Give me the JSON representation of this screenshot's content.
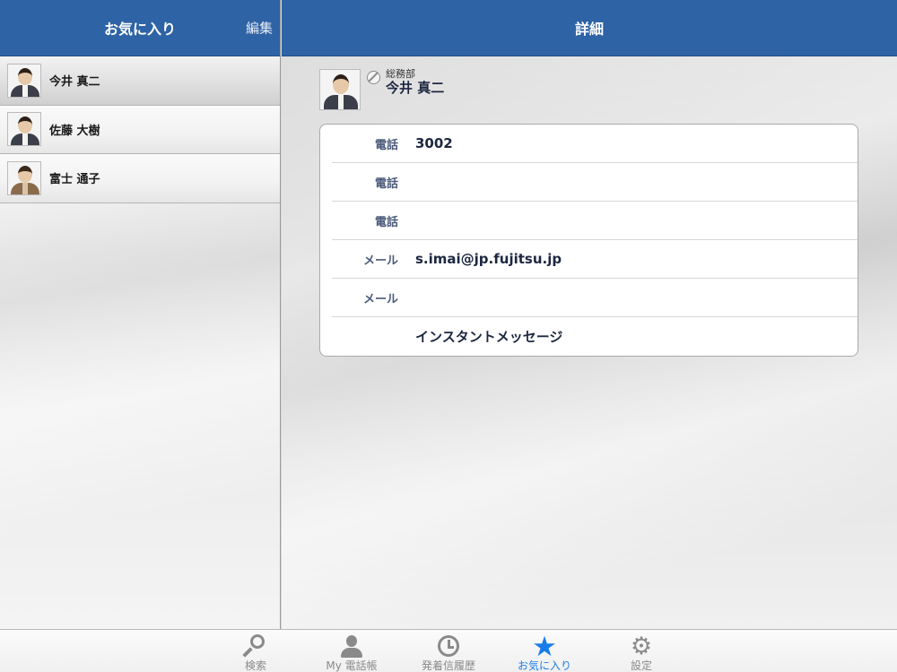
{
  "left": {
    "title": "お気に入り",
    "edit_label": "編集",
    "favorites": [
      {
        "name": "今井 真二",
        "selected": true,
        "avatar": "man-suit-light"
      },
      {
        "name": "佐藤 大樹",
        "selected": false,
        "avatar": "man-suit-glasses"
      },
      {
        "name": "富士 通子",
        "selected": false,
        "avatar": "woman"
      }
    ]
  },
  "right": {
    "title": "詳細",
    "profile": {
      "department": "総務部",
      "name": "今井 真二",
      "status_icon": "status-unavailable-icon"
    },
    "details": [
      {
        "label": "電話",
        "value": "3002"
      },
      {
        "label": "電話",
        "value": ""
      },
      {
        "label": "電話",
        "value": ""
      },
      {
        "label": "メール",
        "value": "s.imai@jp.fujitsu.jp"
      },
      {
        "label": "メール",
        "value": ""
      },
      {
        "label": "",
        "value": "インスタントメッセージ"
      }
    ]
  },
  "tabs": [
    {
      "label": "検索",
      "icon": "search-icon",
      "active": false
    },
    {
      "label": "My 電話帳",
      "icon": "person-icon",
      "active": false
    },
    {
      "label": "発着信履歴",
      "icon": "clock-icon",
      "active": false
    },
    {
      "label": "お気に入り",
      "icon": "star-icon",
      "active": true
    },
    {
      "label": "設定",
      "icon": "gear-icon",
      "active": false
    }
  ],
  "colors": {
    "header_blue": "#2e63a5",
    "active_tab": "#1a7de6",
    "inactive_tab": "#8a8a8a"
  }
}
